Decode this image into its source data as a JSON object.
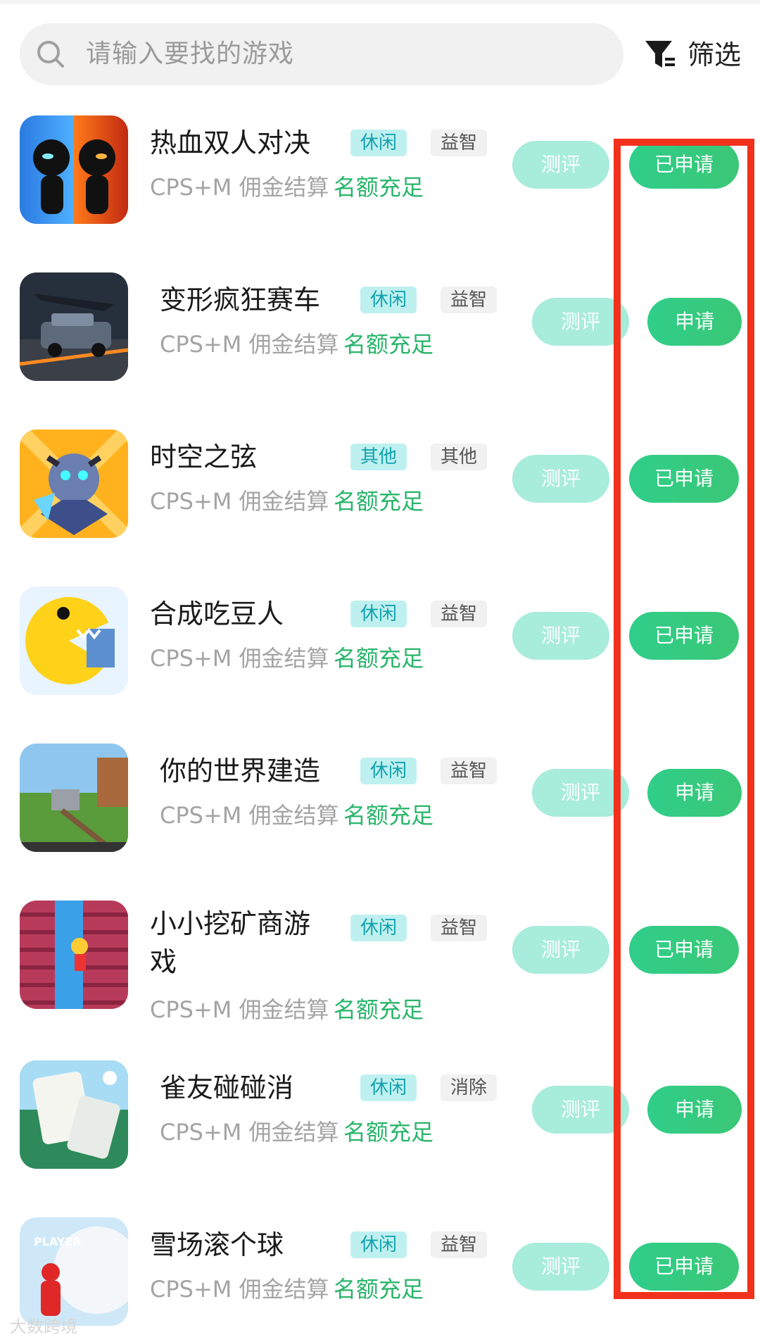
{
  "search": {
    "placeholder": "请输入要找的游戏",
    "icon": "search-icon"
  },
  "filter": {
    "label": "筛选",
    "icon": "filter-icon"
  },
  "games": [
    {
      "name": "热血双人对决",
      "tags": [
        "休闲",
        "益智"
      ],
      "settlement": "CPS+M 佣金结算",
      "quota": "名额充足",
      "review_label": "测评",
      "apply_label": "已申请"
    },
    {
      "name": "变形疯狂赛车",
      "tags": [
        "休闲",
        "益智"
      ],
      "settlement": "CPS+M 佣金结算",
      "quota": "名额充足",
      "review_label": "测评",
      "apply_label": "申请"
    },
    {
      "name": "时空之弦",
      "tags": [
        "其他",
        "其他"
      ],
      "settlement": "CPS+M 佣金结算",
      "quota": "名额充足",
      "review_label": "测评",
      "apply_label": "已申请"
    },
    {
      "name": "合成吃豆人",
      "tags": [
        "休闲",
        "益智"
      ],
      "settlement": "CPS+M 佣金结算",
      "quota": "名额充足",
      "review_label": "测评",
      "apply_label": "已申请"
    },
    {
      "name": "你的世界建造",
      "tags": [
        "休闲",
        "益智"
      ],
      "settlement": "CPS+M 佣金结算",
      "quota": "名额充足",
      "review_label": "测评",
      "apply_label": "申请"
    },
    {
      "name": "小小挖矿商游",
      "name_line2": "戏",
      "tags": [
        "休闲",
        "益智"
      ],
      "settlement": "CPS+M 佣金结算",
      "quota": "名额充足",
      "review_label": "测评",
      "apply_label": "已申请"
    },
    {
      "name": "雀友碰碰消",
      "tags": [
        "休闲",
        "消除"
      ],
      "settlement": "CPS+M 佣金结算",
      "quota": "名额充足",
      "review_label": "测评",
      "apply_label": "申请"
    },
    {
      "name": "雪场滚个球",
      "tags": [
        "休闲",
        "益智"
      ],
      "settlement": "CPS+M 佣金结算",
      "quota": "名额充足",
      "review_label": "测评",
      "apply_label": "已申请"
    }
  ],
  "colors": {
    "accent_green": "#2fce8a",
    "review_button": "#a8ecdb",
    "highlight_box": "#f2311c",
    "tag_cyan": "#bff0f0"
  },
  "watermark": "大数跨境"
}
